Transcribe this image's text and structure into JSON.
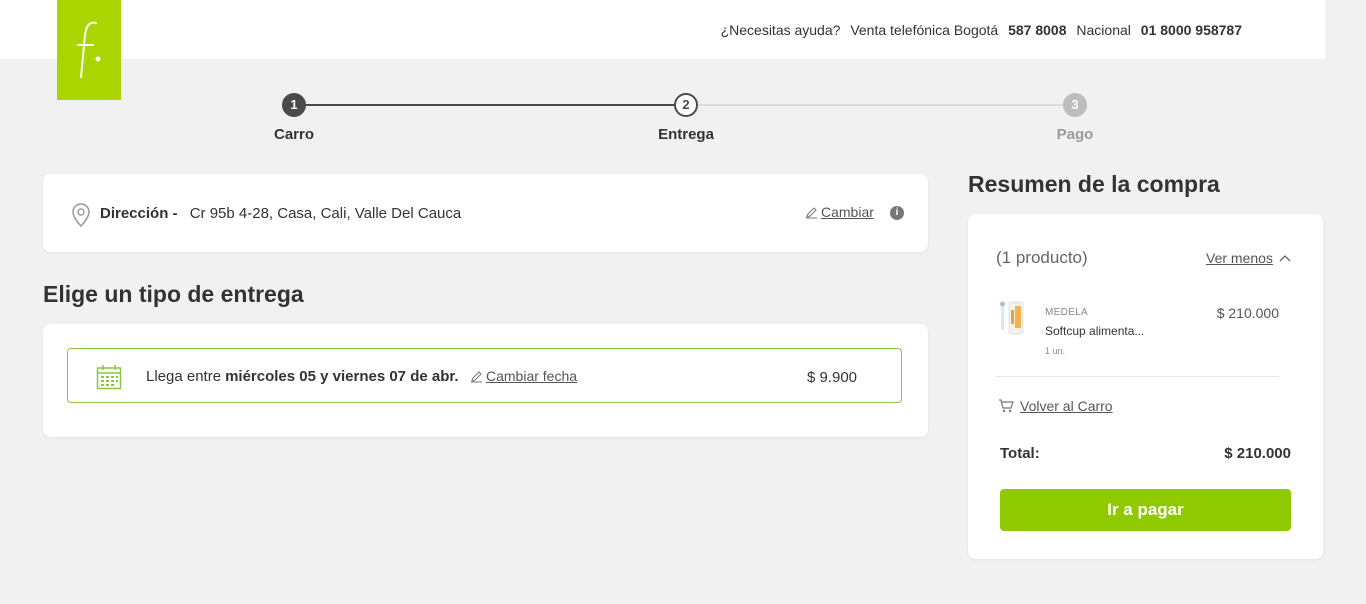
{
  "header": {
    "logo_letter": "f.",
    "help_text": "¿Necesitas ayuda?",
    "phone_local_label": "Venta telefónica Bogotá",
    "phone_local": "587 8008",
    "phone_national_label": "Nacional",
    "phone_national": "01 8000 958787"
  },
  "steps": [
    {
      "number": "1",
      "label": "Carro"
    },
    {
      "number": "2",
      "label": "Entrega"
    },
    {
      "number": "3",
      "label": "Pago"
    }
  ],
  "address": {
    "label": "Dirección -",
    "value": "Cr 95b 4-28, Casa, Cali, Valle Del Cauca",
    "change_label": "Cambiar",
    "info_glyph": "i"
  },
  "delivery": {
    "section_title": "Elige un tipo de entrega",
    "prefix": "Llega entre",
    "dates": "miércoles 05 y viernes 07 de abr.",
    "change_date_label": "Cambiar fecha",
    "price": "$ 9.900"
  },
  "summary": {
    "title": "Resumen de la compra",
    "product_count": "(1 producto)",
    "toggle_label": "Ver menos",
    "items": [
      {
        "brand": "MEDELA",
        "name": "Softcup alimenta...",
        "quantity": "1 un.",
        "price": "$ 210.000"
      }
    ],
    "back_to_cart_label": "Volver al Carro",
    "total_label": "Total:",
    "total_value": "$ 210.000",
    "pay_button_label": "Ir a pagar"
  },
  "colors": {
    "brand_green": "#aad500",
    "button_green": "#8fca00",
    "option_border": "#8cc63f"
  }
}
